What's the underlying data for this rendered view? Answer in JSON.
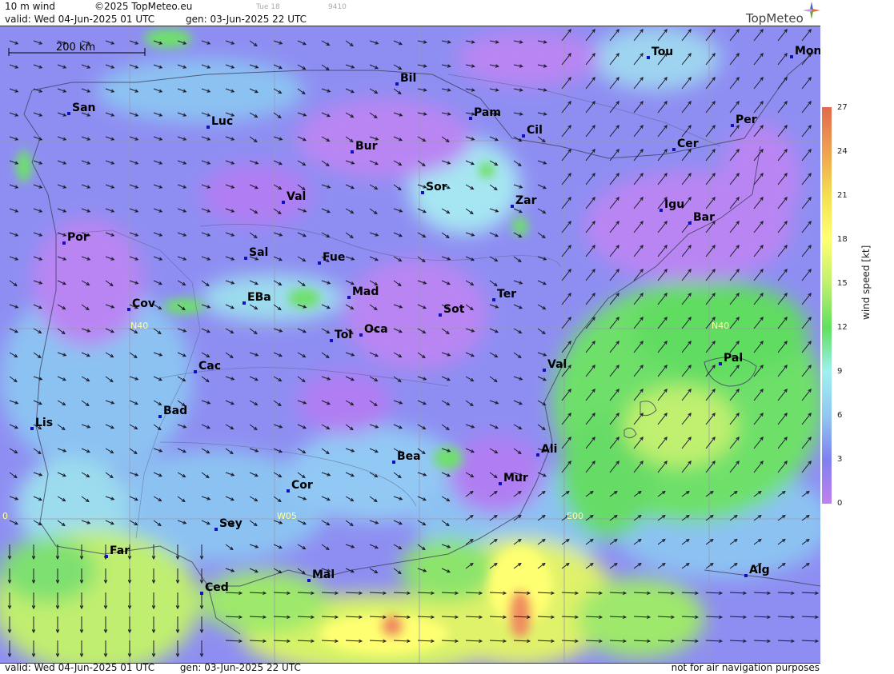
{
  "header": {
    "field": "10 m wind",
    "copyright": "©2025 TopMeteo.eu",
    "small1": "Tue 18",
    "small2": "9410",
    "valid": "valid:  Wed  04-Jun-2025  01 UTC",
    "gen": "gen: 03-Jun-2025 22 UTC",
    "brand": "TopMeteo"
  },
  "footer": {
    "valid": "valid:  Wed  04-Jun-2025  01 UTC",
    "gen": "gen: 03-Jun-2025 22 UTC",
    "disclaimer": "not for air navigation purposes"
  },
  "scale": {
    "label": "200 km"
  },
  "legend": {
    "title": "wind speed [kt]",
    "ticks": [
      "27",
      "24",
      "21",
      "18",
      "15",
      "12",
      "9",
      "6",
      "3",
      "0"
    ],
    "colors": [
      "#e06a50",
      "#f0a050",
      "#f4e050",
      "#ffff70",
      "#c0f070",
      "#60e060",
      "#a0f0f0",
      "#90c8f0",
      "#8080f0",
      "#c080f0"
    ]
  },
  "grid_labels": [
    "N40",
    "N40",
    "W05",
    "E00",
    "0"
  ],
  "cities": [
    "Tou",
    "Mon",
    "Bil",
    "San",
    "Luc",
    "Pam",
    "Cil",
    "Per",
    "Bur",
    "Cer",
    "Sor",
    "Val",
    "Zar",
    "Igu",
    "Bar",
    "Por",
    "Sal",
    "Fue",
    "Mad",
    "EBa",
    "Cov",
    "Ter",
    "Sot",
    "Tol",
    "Oca",
    "Pal",
    "Val",
    "Cac",
    "Bad",
    "Lis",
    "Ali",
    "Bea",
    "Mur",
    "Cor",
    "Sey",
    "Far",
    "Mal",
    "Alg",
    "Ced"
  ]
}
